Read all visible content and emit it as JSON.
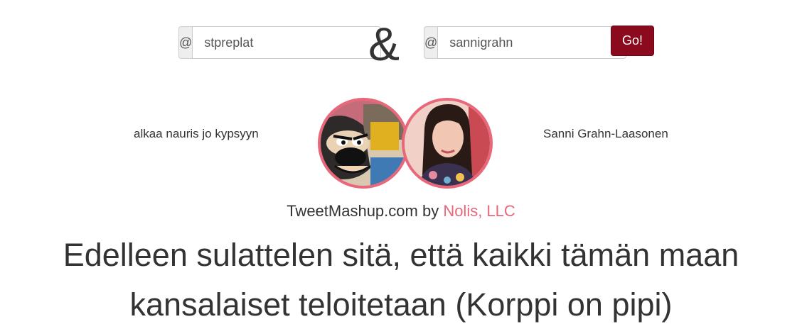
{
  "form": {
    "at_symbol": "@",
    "user1_handle": "stpreplat",
    "ampersand": "&",
    "user2_handle": "sannigrahn",
    "go_label": "Go!"
  },
  "users": {
    "left_name": "alkaa nauris jo kypsyyn",
    "right_name": "Sanni Grahn-Laasonen"
  },
  "credit": {
    "prefix": "TweetMashup.com by",
    "company": "Nolis, LLC"
  },
  "mashup": {
    "text": "Edelleen sulattelen sitä, että kaikki tämän maan kansalaiset teloitetaan (Korppi on pipi)"
  },
  "colors": {
    "accent_pink": "#e8677a",
    "go_button": "#8b0a1d"
  }
}
